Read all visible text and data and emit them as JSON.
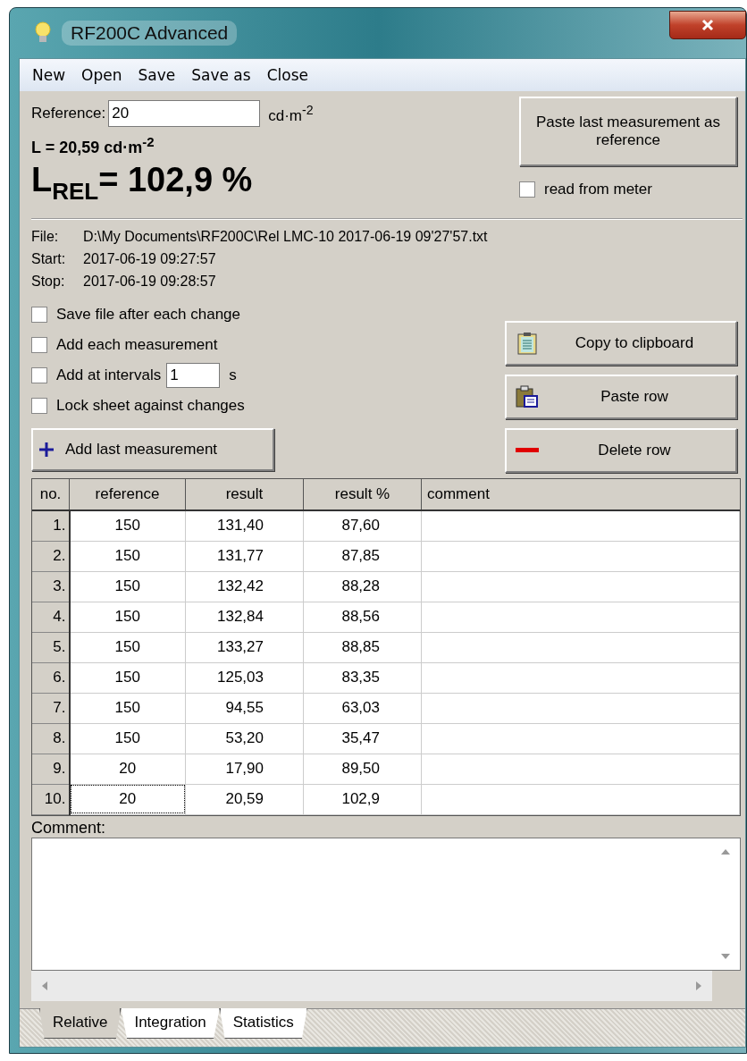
{
  "window": {
    "title": "RF200C Advanced"
  },
  "menu": [
    "New",
    "Open",
    "Save",
    "Save as",
    "Close"
  ],
  "reference": {
    "label": "Reference:",
    "value": "20",
    "unit": "cd·m$^{-2}$"
  },
  "luminance": "L = 20,59 cd·m$^{-2}$",
  "relative": "L$_{REL}$= 102,9 %",
  "paste_reference_button": "Paste last measurement as reference",
  "read_from_meter": {
    "label": "read from meter",
    "checked": false
  },
  "file_info": [
    {
      "label": "File:",
      "value": "D:\\My Documents\\RF200C\\Rel LMC-10 2017-06-19 09'27'57.txt"
    },
    {
      "label": "Start:",
      "value": "2017-06-19 09:27:57"
    },
    {
      "label": "Stop:",
      "value": "2017-06-19 09:28:57"
    }
  ],
  "options": [
    {
      "kind": "checkbox",
      "label": "Save file after each change",
      "checked": false
    },
    {
      "kind": "checkbox",
      "label": "Add each measurement",
      "checked": false
    },
    {
      "kind": "interval",
      "label": "Add at intervals",
      "checked": false,
      "value": "1",
      "unit": "s"
    },
    {
      "kind": "checkbox",
      "label": "Lock sheet against changes",
      "checked": false
    }
  ],
  "add_button": "Add last measurement",
  "side_buttons": [
    {
      "kind": "copy",
      "label": "Copy to clipboard"
    },
    {
      "kind": "paste",
      "label": "Paste row"
    },
    {
      "kind": "delete",
      "label": "Delete row"
    }
  ],
  "table": {
    "columns": [
      "no.",
      "reference",
      "result",
      "result %",
      "comment"
    ],
    "rows": [
      {
        "cells": [
          "1.",
          "150",
          "131,40",
          "87,60"
        ],
        "focused": false
      },
      {
        "cells": [
          "2.",
          "150",
          "131,77",
          "87,85"
        ],
        "focused": false
      },
      {
        "cells": [
          "3.",
          "150",
          "132,42",
          "88,28"
        ],
        "focused": false
      },
      {
        "cells": [
          "4.",
          "150",
          "132,84",
          "88,56"
        ],
        "focused": false
      },
      {
        "cells": [
          "5.",
          "150",
          "133,27",
          "88,85"
        ],
        "focused": false
      },
      {
        "cells": [
          "6.",
          "150",
          "125,03",
          "83,35"
        ],
        "focused": false
      },
      {
        "cells": [
          "7.",
          "150",
          "94,55",
          "63,03"
        ],
        "focused": false
      },
      {
        "cells": [
          "8.",
          "150",
          "53,20",
          "35,47"
        ],
        "focused": false
      },
      {
        "cells": [
          "9.",
          "20",
          "17,90",
          "89,50"
        ],
        "focused": false
      },
      {
        "cells": [
          "10.",
          "20",
          "20,59",
          "102,9"
        ],
        "focused": true
      }
    ]
  },
  "comment": {
    "label": "Comment:"
  },
  "tabs": [
    {
      "label": "Relative",
      "selected": true
    },
    {
      "label": "Integration",
      "selected": false
    },
    {
      "label": "Statistics",
      "selected": false
    }
  ]
}
